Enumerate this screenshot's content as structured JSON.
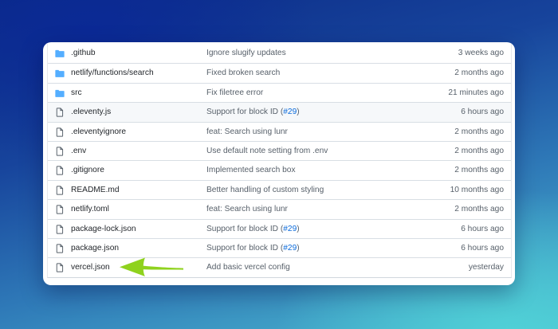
{
  "colors": {
    "folder_icon": "#54aeff",
    "file_icon": "#57606a",
    "link": "#0969da",
    "arrow": "#8fd21e"
  },
  "files": [
    {
      "type": "folder",
      "icon": "folder-icon",
      "name": ".github",
      "message": "Ignore slugify updates",
      "age": "3 weeks ago"
    },
    {
      "type": "folder",
      "icon": "folder-icon",
      "name": "netlify/functions/search",
      "message": "Fixed broken search",
      "age": "2 months ago"
    },
    {
      "type": "folder",
      "icon": "folder-icon",
      "name": "src",
      "message": "Fix filetree error",
      "age": "21 minutes ago"
    },
    {
      "type": "file",
      "icon": "file-icon",
      "name": ".eleventy.js",
      "message_pre": "Support for block ID (",
      "message_link": "#29",
      "message_post": ")",
      "age": "6 hours ago"
    },
    {
      "type": "file",
      "icon": "file-icon",
      "name": ".eleventyignore",
      "message": "feat: Search using lunr",
      "age": "2 months ago"
    },
    {
      "type": "file",
      "icon": "file-icon",
      "name": ".env",
      "message": "Use default note setting from .env",
      "age": "2 months ago"
    },
    {
      "type": "file",
      "icon": "file-icon",
      "name": ".gitignore",
      "message": "Implemented search box",
      "age": "2 months ago"
    },
    {
      "type": "file",
      "icon": "file-icon",
      "name": "README.md",
      "message": "Better handling of custom styling",
      "age": "10 months ago"
    },
    {
      "type": "file",
      "icon": "file-icon",
      "name": "netlify.toml",
      "message": "feat: Search using lunr",
      "age": "2 months ago"
    },
    {
      "type": "file",
      "icon": "file-icon",
      "name": "package-lock.json",
      "message_pre": "Support for block ID (",
      "message_link": "#29",
      "message_post": ")",
      "age": "6 hours ago"
    },
    {
      "type": "file",
      "icon": "file-icon",
      "name": "package.json",
      "message_pre": "Support for block ID (",
      "message_link": "#29",
      "message_post": ")",
      "age": "6 hours ago"
    },
    {
      "type": "file",
      "icon": "file-icon",
      "name": "vercel.json",
      "message": "Add basic vercel config",
      "age": "yesterday"
    }
  ],
  "annotation": {
    "icon": "arrow-left-icon"
  }
}
